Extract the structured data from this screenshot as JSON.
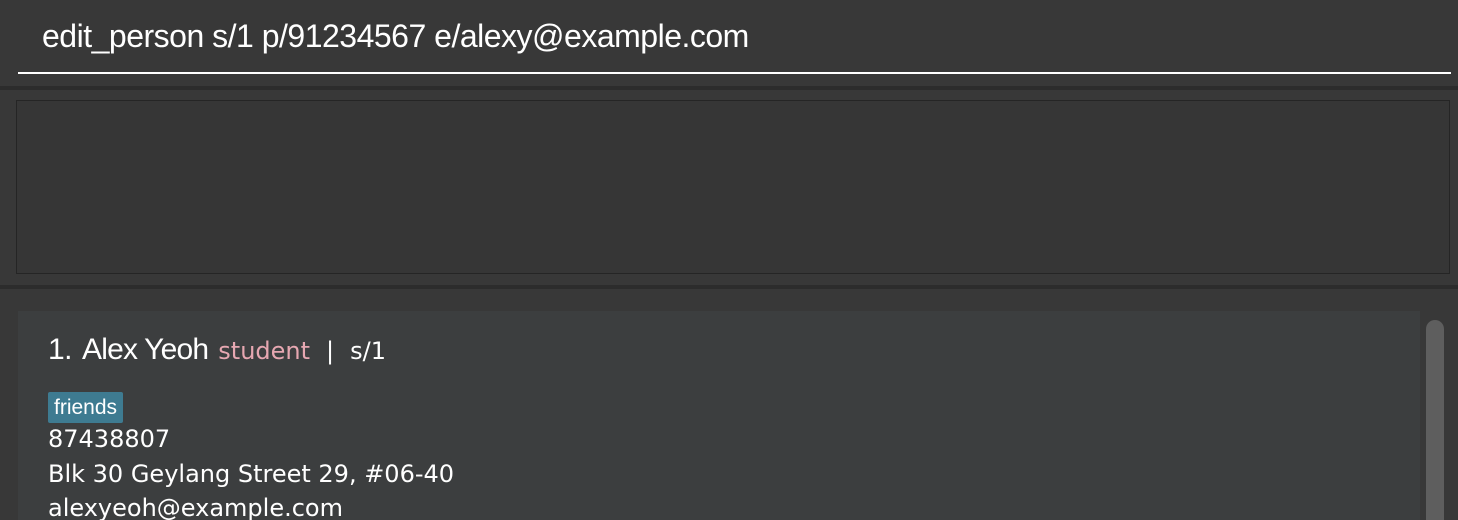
{
  "command_box": {
    "value": "edit_person s/1 p/91234567 e/alexy@example.com"
  },
  "result_display": {
    "text": ""
  },
  "person_list": {
    "persons": [
      {
        "index": "1.",
        "name": "Alex Yeoh",
        "role": "student",
        "separator": "|",
        "id": "s/1",
        "tags": [
          "friends"
        ],
        "phone": "87438807",
        "address": "Blk 30 Geylang Street 29, #06-40",
        "email": "alexyeoh@example.com"
      }
    ]
  },
  "colors": {
    "background": "#383838",
    "card": "#3c3e3f",
    "role": "#e6a7b1",
    "tag": "#3e7b91",
    "scrollbar": "#5e5e5e"
  }
}
